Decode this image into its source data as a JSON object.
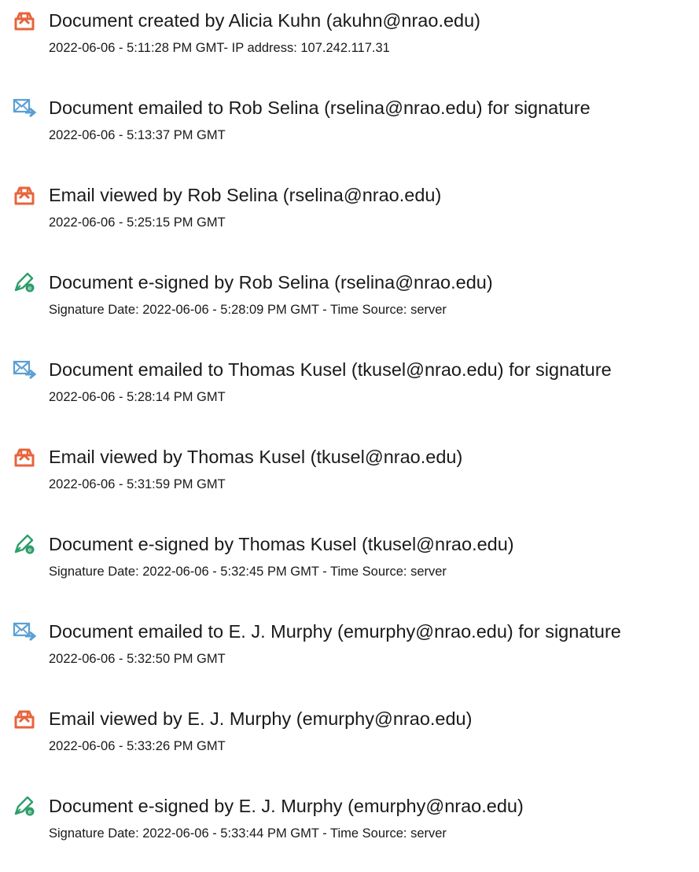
{
  "events": [
    {
      "icon": "document-created-icon",
      "title": "Document created by Alicia Kuhn (akuhn@nrao.edu)",
      "detail": "2022-06-06 - 5:11:28 PM GMT- IP address: 107.242.117.31"
    },
    {
      "icon": "email-sent-icon",
      "title": "Document emailed to Rob Selina (rselina@nrao.edu) for signature",
      "detail": "2022-06-06 - 5:13:37 PM GMT"
    },
    {
      "icon": "email-viewed-icon",
      "title": "Email viewed by Rob Selina (rselina@nrao.edu)",
      "detail": "2022-06-06 - 5:25:15 PM GMT"
    },
    {
      "icon": "esigned-icon",
      "title": "Document e-signed by Rob Selina (rselina@nrao.edu)",
      "detail": "Signature Date: 2022-06-06 - 5:28:09 PM GMT - Time Source: server"
    },
    {
      "icon": "email-sent-icon",
      "title": "Document emailed to Thomas Kusel (tkusel@nrao.edu) for signature",
      "detail": "2022-06-06 - 5:28:14 PM GMT"
    },
    {
      "icon": "email-viewed-icon",
      "title": "Email viewed by Thomas Kusel (tkusel@nrao.edu)",
      "detail": "2022-06-06 - 5:31:59 PM GMT"
    },
    {
      "icon": "esigned-icon",
      "title": "Document e-signed by Thomas Kusel (tkusel@nrao.edu)",
      "detail": "Signature Date: 2022-06-06 - 5:32:45 PM GMT - Time Source: server"
    },
    {
      "icon": "email-sent-icon",
      "title": "Document emailed to E. J. Murphy (emurphy@nrao.edu) for signature",
      "detail": "2022-06-06 - 5:32:50 PM GMT"
    },
    {
      "icon": "email-viewed-icon",
      "title": "Email viewed by E. J. Murphy (emurphy@nrao.edu)",
      "detail": "2022-06-06 - 5:33:26 PM GMT"
    },
    {
      "icon": "esigned-icon",
      "title": "Document e-signed by E. J. Murphy (emurphy@nrao.edu)",
      "detail": "Signature Date: 2022-06-06 - 5:33:44 PM GMT - Time Source: server"
    }
  ],
  "colors": {
    "document_icon": "#e8643c",
    "email_icon": "#5a9fd4",
    "sign_icon": "#2e9e6a",
    "text": "#1a1a1a"
  }
}
